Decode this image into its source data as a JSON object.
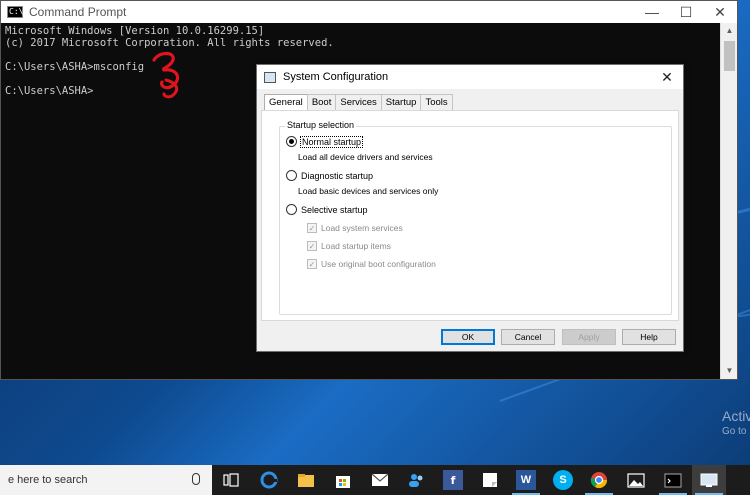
{
  "cmd": {
    "title": "Command Prompt",
    "lines": [
      "Microsoft Windows [Version 10.0.16299.15]",
      "(c) 2017 Microsoft Corporation. All rights reserved.",
      "",
      "C:\\Users\\ASHA>msconfig",
      "",
      "C:\\Users\\ASHA>"
    ],
    "controls": {
      "minimize": "—",
      "maximize": "☐",
      "close": "✕"
    }
  },
  "annotation": {
    "text": "3",
    "color": "#e0141e"
  },
  "dialog": {
    "title": "System Configuration",
    "close": "✕",
    "tabs": [
      "General",
      "Boot",
      "Services",
      "Startup",
      "Tools"
    ],
    "active_tab": "General",
    "group_label": "Startup selection",
    "options": [
      {
        "label": "Normal startup",
        "description": "Load all device drivers and services",
        "selected": true
      },
      {
        "label": "Diagnostic startup",
        "description": "Load basic devices and services only",
        "selected": false
      },
      {
        "label": "Selective startup",
        "description": "",
        "selected": false
      }
    ],
    "selective_items": [
      {
        "label": "Load system services",
        "checked": true,
        "enabled": false
      },
      {
        "label": "Load startup items",
        "checked": true,
        "enabled": false
      },
      {
        "label": "Use original boot configuration",
        "checked": true,
        "enabled": false
      }
    ],
    "buttons": {
      "ok": "OK",
      "cancel": "Cancel",
      "apply": "Apply",
      "help": "Help"
    }
  },
  "watermark": {
    "line1": "Activ",
    "line2": "Go to"
  },
  "taskbar": {
    "search_placeholder": "e here to search",
    "icons": [
      "mic-icon",
      "task-view-icon",
      "edge-icon",
      "file-explorer-icon",
      "store-icon",
      "mail-icon",
      "people-icon",
      "facebook-icon",
      "sticky-notes-icon",
      "word-icon",
      "skype-icon",
      "chrome-icon",
      "photos-icon",
      "command-prompt-icon",
      "system-configuration-icon"
    ]
  },
  "colors": {
    "accent": "#0078d7",
    "desktop": "#0e4a8f",
    "console_bg": "#0c0c0c"
  }
}
